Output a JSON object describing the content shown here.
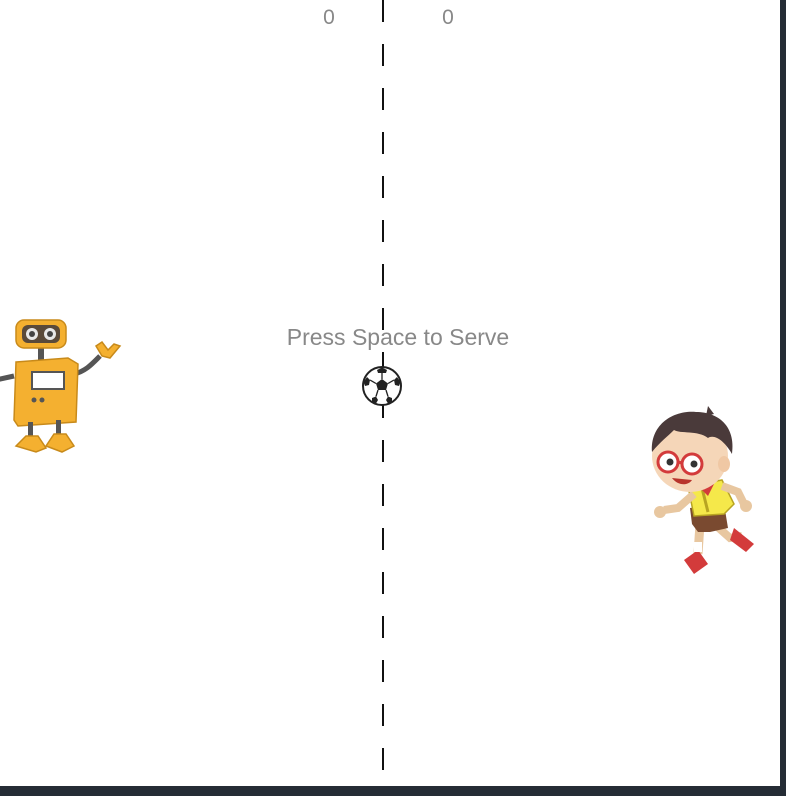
{
  "scores": {
    "left": "0",
    "right": "0"
  },
  "message": "Press Space to Serve",
  "colors": {
    "background": "#ffffff",
    "text": "#888888",
    "net": "#111111",
    "frame": "#252c35",
    "robot_body": "#f4b030",
    "robot_dark": "#555555",
    "kid_shirt": "#f5e84a",
    "kid_hair": "#4a3a3a",
    "kid_glasses": "#d33b3b"
  },
  "sprites": {
    "left_paddle": "robot-player",
    "right_paddle": "kid-player",
    "ball": "soccer-ball"
  }
}
